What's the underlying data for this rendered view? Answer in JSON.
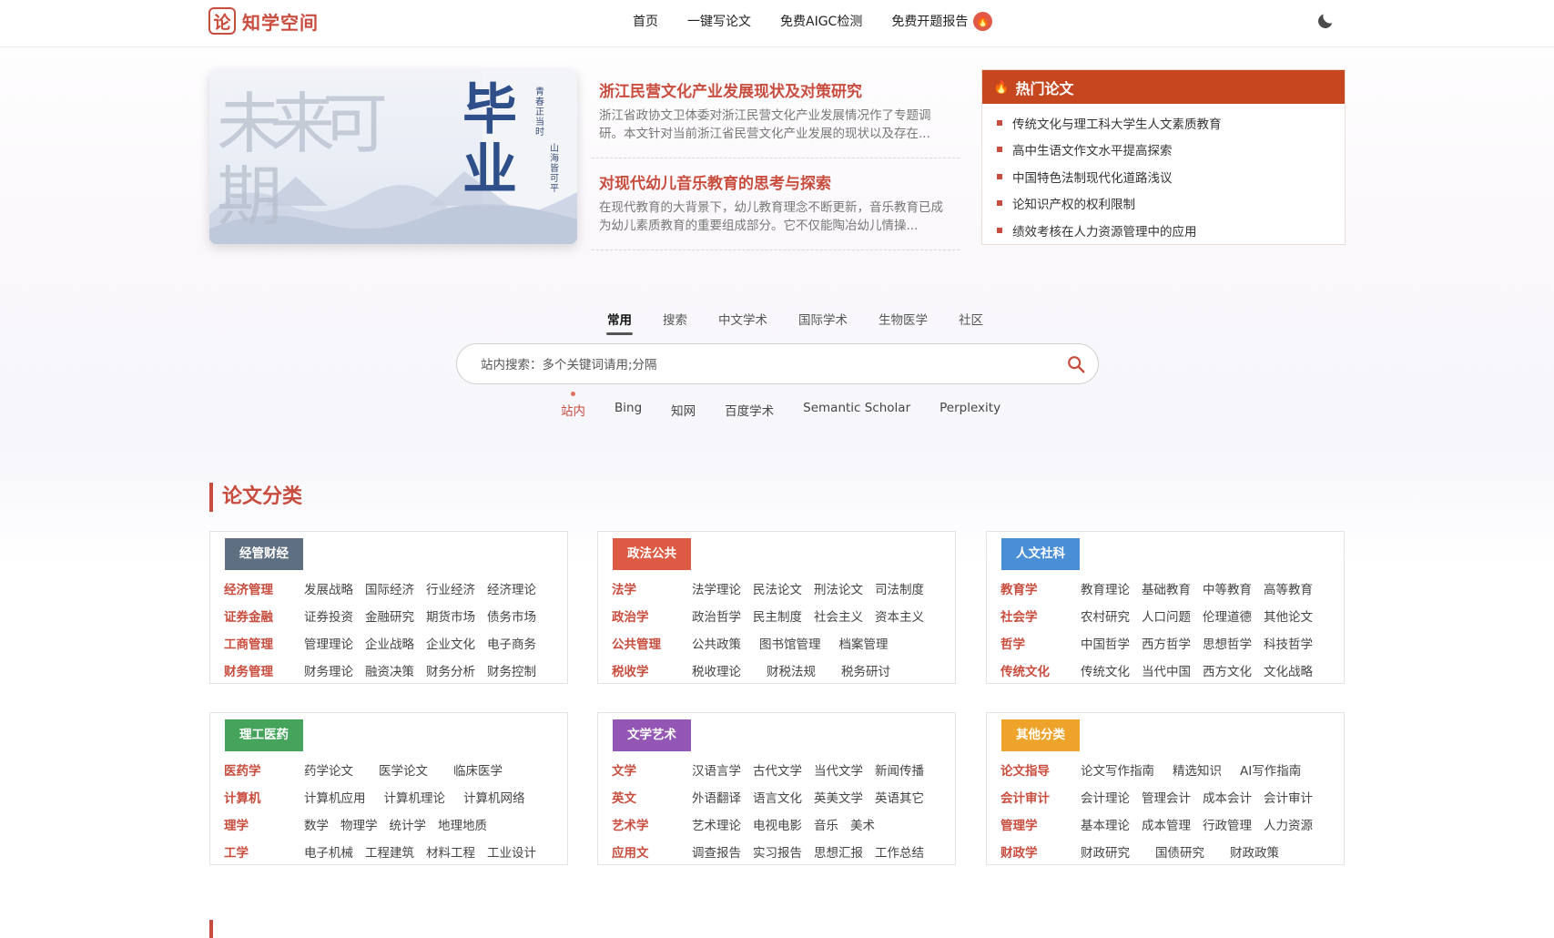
{
  "site": {
    "logo_icon": "论",
    "logo_text": "知学空间"
  },
  "nav": [
    "首页",
    "一键写论文",
    "免费AIGC检测",
    "免费开题报告"
  ],
  "banner": {
    "chars_left": "未来可期",
    "chars_right": "毕业",
    "vertical_small_1": "青春正当时",
    "vertical_small_2": "山海皆可平"
  },
  "featured": [
    {
      "title": "浙江民营文化产业发展现状及对策研究",
      "summary": "浙江省政协文卫体委对浙江民营文化产业发展情况作了专题调研。本文针对当前浙江省民营文化产业发展的现状以及存在..."
    },
    {
      "title": "对现代幼儿音乐教育的思考与探索",
      "summary": "在现代教育的大背景下，幼儿教育理念不断更新，音乐教育已成为幼儿素质教育的重要组成部分。它不仅能陶冶幼儿情操..."
    }
  ],
  "hot": {
    "title": "热门论文",
    "items": [
      "传统文化与理工科大学生人文素质教育",
      "高中生语文作文水平提高探索",
      "中国特色法制现代化道路浅议",
      "论知识产权的权利限制",
      "绩效考核在人力资源管理中的应用"
    ]
  },
  "search": {
    "tabs": [
      "常用",
      "搜索",
      "中文学术",
      "国际学术",
      "生物医学",
      "社区"
    ],
    "placeholder": "站内搜索：多个关键词请用;分隔",
    "engines": [
      "站内",
      "Bing",
      "知网",
      "百度学术",
      "Semantic Scholar",
      "Perplexity"
    ]
  },
  "section_title": "论文分类",
  "categories": [
    {
      "name": "经管财经",
      "color": "#5f6f82",
      "rows": [
        {
          "main": "经济管理",
          "subs": [
            "发展战略",
            "国际经济",
            "行业经济",
            "经济理论"
          ]
        },
        {
          "main": "证券金融",
          "subs": [
            "证券投资",
            "金融研究",
            "期货市场",
            "债务市场"
          ]
        },
        {
          "main": "工商管理",
          "subs": [
            "管理理论",
            "企业战略",
            "企业文化",
            "电子商务"
          ]
        },
        {
          "main": "财务管理",
          "subs": [
            "财务理论",
            "融资决策",
            "财务分析",
            "财务控制"
          ]
        }
      ]
    },
    {
      "name": "政法公共",
      "color": "#dd5b44",
      "rows": [
        {
          "main": "法学",
          "subs": [
            "法学理论",
            "民法论文",
            "刑法论文",
            "司法制度"
          ]
        },
        {
          "main": "政治学",
          "subs": [
            "政治哲学",
            "民主制度",
            "社会主义",
            "资本主义"
          ]
        },
        {
          "main": "公共管理",
          "subs": [
            "公共政策",
            "图书馆管理",
            "档案管理"
          ]
        },
        {
          "main": "税收学",
          "subs": [
            "税收理论",
            "财税法规",
            "税务研讨"
          ]
        }
      ]
    },
    {
      "name": "人文社科",
      "color": "#4a8fd6",
      "rows": [
        {
          "main": "教育学",
          "subs": [
            "教育理论",
            "基础教育",
            "中等教育",
            "高等教育"
          ]
        },
        {
          "main": "社会学",
          "subs": [
            "农村研究",
            "人口问题",
            "伦理道德",
            "其他论文"
          ]
        },
        {
          "main": "哲学",
          "subs": [
            "中国哲学",
            "西方哲学",
            "思想哲学",
            "科技哲学"
          ]
        },
        {
          "main": "传统文化",
          "subs": [
            "传统文化",
            "当代中国",
            "西方文化",
            "文化战略"
          ]
        }
      ]
    },
    {
      "name": "理工医药",
      "color": "#45a35b",
      "rows": [
        {
          "main": "医药学",
          "subs": [
            "药学论文",
            "医学论文",
            "临床医学"
          ]
        },
        {
          "main": "计算机",
          "subs": [
            "计算机应用",
            "计算机理论",
            "计算机网络"
          ]
        },
        {
          "main": "理学",
          "subs": [
            "数学",
            "物理学",
            "统计学",
            "地理地质"
          ]
        },
        {
          "main": "工学",
          "subs": [
            "电子机械",
            "工程建筑",
            "材料工程",
            "工业设计"
          ]
        }
      ]
    },
    {
      "name": "文学艺术",
      "color": "#9456b5",
      "rows": [
        {
          "main": "文学",
          "subs": [
            "汉语言学",
            "古代文学",
            "当代文学",
            "新闻传播"
          ]
        },
        {
          "main": "英文",
          "subs": [
            "外语翻译",
            "语言文化",
            "英美文学",
            "英语其它"
          ]
        },
        {
          "main": "艺术学",
          "subs": [
            "艺术理论",
            "电视电影",
            "音乐",
            "美术"
          ]
        },
        {
          "main": "应用文",
          "subs": [
            "调查报告",
            "实习报告",
            "思想汇报",
            "工作总结"
          ]
        }
      ]
    },
    {
      "name": "其他分类",
      "color": "#eea32a",
      "rows": [
        {
          "main": "论文指导",
          "subs": [
            "论文写作指南",
            "精选知识",
            "AI写作指南"
          ]
        },
        {
          "main": "会计审计",
          "subs": [
            "会计理论",
            "管理会计",
            "成本会计",
            "会计审计"
          ]
        },
        {
          "main": "管理学",
          "subs": [
            "基本理论",
            "成本管理",
            "行政管理",
            "人力资源"
          ]
        },
        {
          "main": "财政学",
          "subs": [
            "财政研究",
            "国债研究",
            "财政政策"
          ]
        }
      ]
    }
  ]
}
